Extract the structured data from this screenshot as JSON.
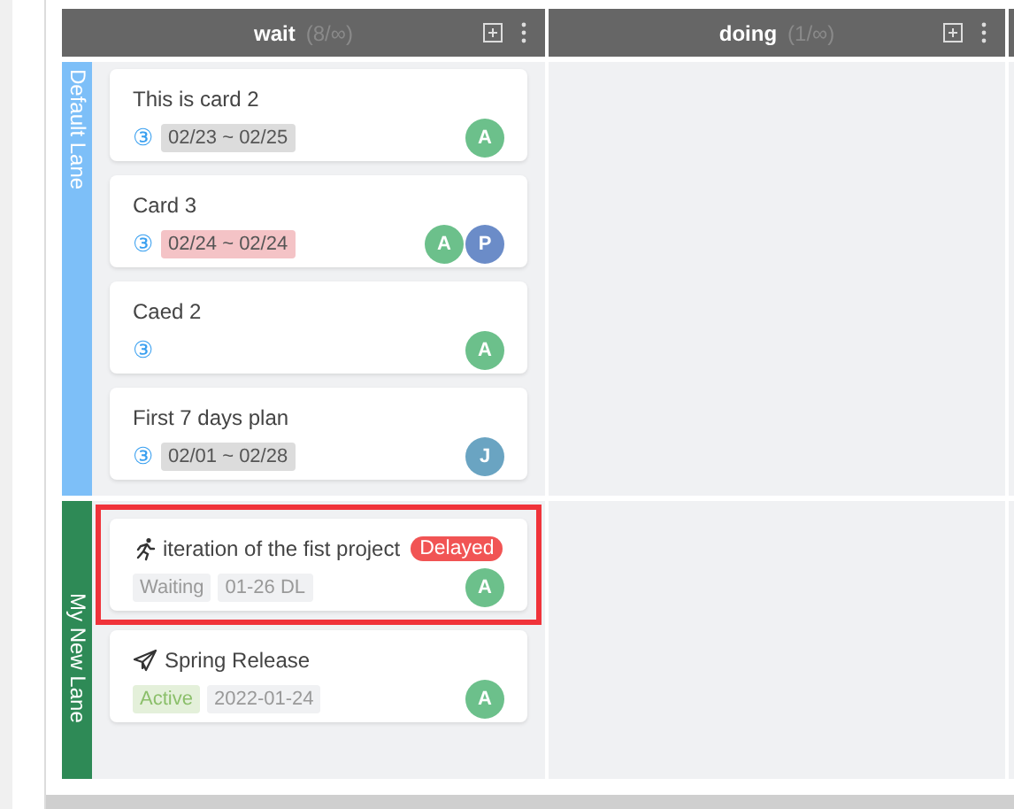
{
  "columns": [
    {
      "title": "wait",
      "count": "(8/∞)"
    },
    {
      "title": "doing",
      "count": "(1/∞)"
    }
  ],
  "lanes": [
    {
      "name": "Default Lane",
      "color": "#7dbff8",
      "cards": [
        {
          "kind": "card",
          "title": "This is card 2",
          "priority": "③",
          "tags": [
            {
              "kind": "range",
              "text": "02/23 ~ 02/25"
            }
          ],
          "avatars": [
            {
              "initial": "A",
              "color": "#6cc08b"
            }
          ],
          "highlighted": false
        },
        {
          "kind": "card",
          "title": "Card 3",
          "priority": "③",
          "tags": [
            {
              "kind": "range-overdue",
              "text": "02/24 ~ 02/24"
            }
          ],
          "avatars": [
            {
              "initial": "A",
              "color": "#6cc08b"
            },
            {
              "initial": "P",
              "color": "#6b8cc8"
            }
          ],
          "highlighted": false
        },
        {
          "kind": "card",
          "title": "Caed 2",
          "priority": "③",
          "avatars": [
            {
              "initial": "A",
              "color": "#6cc08b"
            }
          ],
          "highlighted": false
        },
        {
          "kind": "card",
          "title": "First 7 days plan",
          "priority": "③",
          "tags": [
            {
              "kind": "range",
              "text": "02/01 ~ 02/28"
            }
          ],
          "avatars": [
            {
              "initial": "J",
              "color": "#6aa4c2"
            }
          ],
          "highlighted": false
        }
      ]
    },
    {
      "name": "My New Lane",
      "color": "#2e8a56",
      "cards": [
        {
          "kind": "iteration",
          "title": "iteration of the fist project",
          "badge": "Delayed",
          "tags": [
            {
              "kind": "status",
              "text": "Waiting"
            },
            {
              "kind": "date",
              "text": "01-26 DL"
            }
          ],
          "avatars": [
            {
              "initial": "A",
              "color": "#6cc08b"
            }
          ],
          "highlighted": true
        },
        {
          "kind": "release",
          "title": "Spring Release",
          "tags": [
            {
              "kind": "status-active",
              "text": "Active"
            },
            {
              "kind": "date",
              "text": "2022-01-24"
            }
          ],
          "avatars": [
            {
              "initial": "A",
              "color": "#6cc08b"
            }
          ],
          "highlighted": false
        }
      ]
    }
  ]
}
